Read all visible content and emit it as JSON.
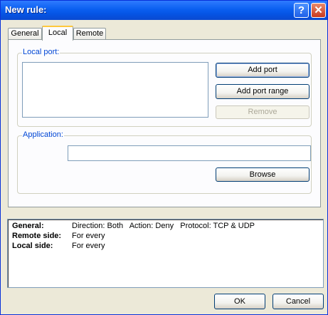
{
  "window": {
    "title": "New rule:"
  },
  "titlebar": {
    "help_glyph": "?",
    "close_glyph": "✕"
  },
  "tabs": [
    {
      "label": "General",
      "active": false
    },
    {
      "label": "Local",
      "active": true
    },
    {
      "label": "Remote",
      "active": false
    }
  ],
  "local_port": {
    "legend": "Local port:",
    "add_port": "Add port",
    "add_port_range": "Add port range",
    "remove": "Remove"
  },
  "application": {
    "legend": "Application:",
    "path_value": "",
    "browse": "Browse"
  },
  "summary": {
    "rows": [
      {
        "label": "General:",
        "value": "Direction: Both   Action: Deny   Protocol: TCP & UDP"
      },
      {
        "label": "Remote side:",
        "value": "For every"
      },
      {
        "label": "Local side:",
        "value": "For every"
      }
    ]
  },
  "footer": {
    "ok": "OK",
    "cancel": "Cancel"
  }
}
